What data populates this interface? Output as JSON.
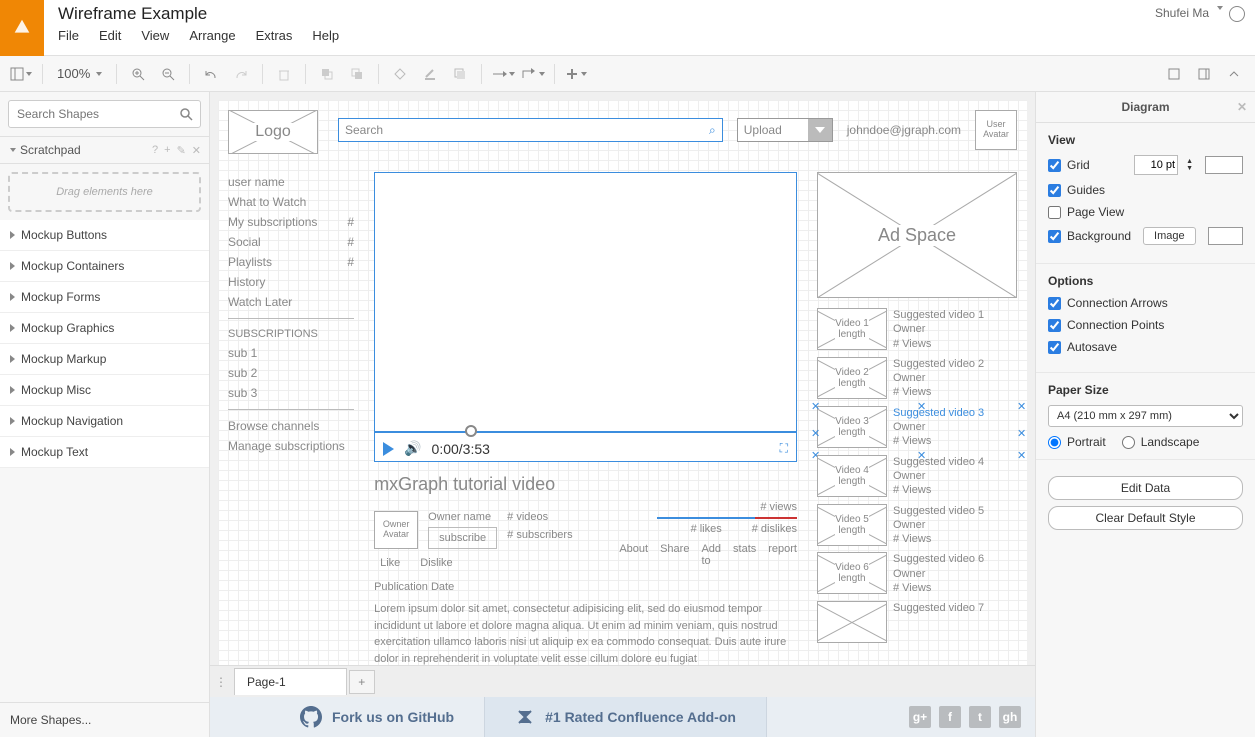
{
  "header": {
    "doc_title": "Wireframe Example",
    "user_name": "Shufei Ma",
    "menu": [
      "File",
      "Edit",
      "View",
      "Arrange",
      "Extras",
      "Help"
    ]
  },
  "toolbar": {
    "zoom": "100%"
  },
  "left": {
    "search_placeholder": "Search Shapes",
    "scratchpad_label": "Scratchpad",
    "drop_hint": "Drag elements here",
    "categories": [
      "Mockup Buttons",
      "Mockup Containers",
      "Mockup Forms",
      "Mockup Graphics",
      "Mockup Markup",
      "Mockup Misc",
      "Mockup Navigation",
      "Mockup Text"
    ],
    "more": "More Shapes..."
  },
  "canvas": {
    "logo": "Logo",
    "search_ph": "Search",
    "upload": "Upload",
    "email": "johndoe@jgraph.com",
    "user_avatar": "User Avatar",
    "nav": {
      "items": [
        "user name",
        "What to Watch",
        "My subscriptions",
        "Social",
        "Playlists",
        "History",
        "Watch Later"
      ],
      "subs_head": "SUBSCRIPTIONS",
      "subs": [
        "sub 1",
        "sub 2",
        "sub 3"
      ],
      "browse": "Browse channels",
      "manage": "Manage subscriptions"
    },
    "player": {
      "time": "0:00/3:53",
      "title": "mxGraph tutorial video",
      "owner_avatar": "Owner Avatar",
      "owner_name": "Owner name",
      "subscribe": "subscribe",
      "videos": "# videos",
      "subscribers": "# subscribers",
      "views": "# views",
      "likes": "# likes",
      "dislikes": "# dislikes",
      "like": "Like",
      "dislike": "Dislike",
      "actions": [
        "About",
        "Share",
        "Add to",
        "stats",
        "report"
      ],
      "pub": "Publication Date",
      "lorem": "Lorem ipsum dolor sit amet, consectetur adipisicing elit, sed do eiusmod tempor incididunt ut labore et dolore magna aliqua. Ut enim ad minim veniam, quis nostrud exercitation ullamco laboris nisi ut aliquip ex ea commodo consequat. Duis aute irure dolor in reprehenderit in voluptate velit esse cillum dolore eu fugiat"
    },
    "ad": "Ad Space",
    "suggestions": [
      {
        "thumb": "Video 1",
        "len": "length",
        "title": "Suggested video 1",
        "owner": "Owner",
        "views": "# Views"
      },
      {
        "thumb": "Video 2",
        "len": "length",
        "title": "Suggested video 2",
        "owner": "Owner",
        "views": "# Views"
      },
      {
        "thumb": "Video 3",
        "len": "length",
        "title": "Suggested video 3",
        "owner": "Owner",
        "views": "# Views"
      },
      {
        "thumb": "Video 4",
        "len": "length",
        "title": "Suggested video 4",
        "owner": "Owner",
        "views": "# Views"
      },
      {
        "thumb": "Video 5",
        "len": "length",
        "title": "Suggested video 5",
        "owner": "Owner",
        "views": "# Views"
      },
      {
        "thumb": "Video 6",
        "len": "length",
        "title": "Suggested video 6",
        "owner": "Owner",
        "views": "# Views"
      },
      {
        "thumb": "",
        "len": "",
        "title": "Suggested video 7",
        "owner": "",
        "views": ""
      }
    ]
  },
  "tabs": {
    "page1": "Page-1"
  },
  "right": {
    "title": "Diagram",
    "view": {
      "head": "View",
      "grid": "Grid",
      "grid_val": "10 pt",
      "guides": "Guides",
      "page_view": "Page View",
      "background": "Background",
      "image_btn": "Image"
    },
    "options": {
      "head": "Options",
      "conn_arrows": "Connection Arrows",
      "conn_points": "Connection Points",
      "autosave": "Autosave"
    },
    "paper": {
      "head": "Paper Size",
      "value": "A4 (210 mm x 297 mm)",
      "portrait": "Portrait",
      "landscape": "Landscape"
    },
    "edit_data": "Edit Data",
    "clear_style": "Clear Default Style"
  },
  "footer": {
    "fork": "Fork us on GitHub",
    "confluence": "#1 Rated Confluence Add-on"
  }
}
